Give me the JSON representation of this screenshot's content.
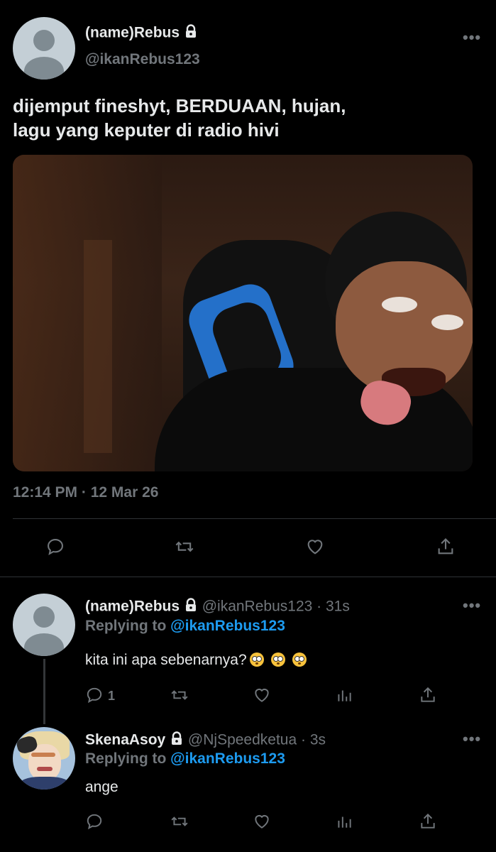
{
  "main_tweet": {
    "author_name": "(name)Rebus",
    "handle": "@ikanRebus123",
    "text_line1": "dijemput fineshyt, BERDUAAN, hujan,",
    "text_line2": "lagu yang keputer di radio hivi",
    "timestamp": "12:14 PM · 12 Mar 26",
    "more_label": "•••",
    "actions": [
      "reply-icon",
      "retweet-icon",
      "like-icon",
      "share-icon"
    ]
  },
  "replies": [
    {
      "author_name": "(name)Rebus",
      "handle_time": "@ikanRebus123 · 31s",
      "replying_prefix": "Replying to ",
      "replying_to": "@ikanRebus123",
      "text": "kita ini apa sebenarnya?",
      "emoji": [
        "flushed-face",
        "flushed-face",
        "flushed-face"
      ],
      "reply_count": "1",
      "more_label": "•••"
    },
    {
      "author_name": "SkenaAsoy",
      "handle_time": "@NjSpeedketua · 3s",
      "replying_prefix": "Replying to ",
      "replying_to": "@ikanRebus123",
      "text": "ange",
      "reply_count": "",
      "more_label": "•••"
    }
  ],
  "colors": {
    "background": "#000000",
    "text": "#e7e9ea",
    "muted": "#71767b",
    "link": "#1d9bf0",
    "divider": "#2f3336"
  }
}
